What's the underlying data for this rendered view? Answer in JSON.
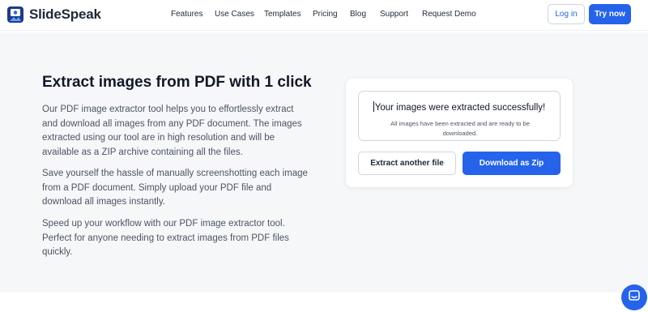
{
  "brand": {
    "name": "SlideSpeak",
    "primary_color": "#2563eb"
  },
  "nav": {
    "items": [
      {
        "label": "Features"
      },
      {
        "label": "Use Cases"
      },
      {
        "label": "Templates"
      },
      {
        "label": "Pricing"
      },
      {
        "label": "Blog"
      },
      {
        "label": "Support"
      },
      {
        "label": "Request Demo"
      }
    ],
    "login_label": "Log in",
    "try_label": "Try now"
  },
  "hero": {
    "title": "Extract images from PDF with 1 click",
    "paragraphs": [
      "Our PDF image extractor tool helps you to effortlessly extract and download all images from any PDF document. The images extracted using our tool are in high resolution and will be available as a ZIP archive containing all the files.",
      "Save yourself the hassle of manually screenshotting each image from a PDF document. Simply upload your PDF file and download all images instantly.",
      "Speed up your workflow with our PDF image extractor tool. Perfect for anyone needing to extract images from PDF files quickly."
    ]
  },
  "result_card": {
    "title": "Your images were extracted successfully!",
    "subtitle": "All images have been extracted and are ready to be downloaded.",
    "extract_another_label": "Extract another file",
    "download_label": "Download as Zip"
  },
  "chat_widget": {
    "icon": "chat-icon"
  }
}
